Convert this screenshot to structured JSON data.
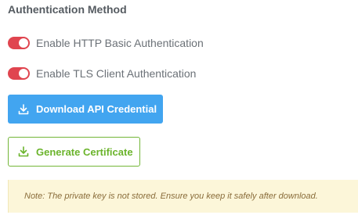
{
  "section": {
    "title": "Authentication Method"
  },
  "toggles": [
    {
      "label": "Enable HTTP Basic Authentication",
      "enabled": true
    },
    {
      "label": "Enable TLS Client Authentication",
      "enabled": true
    }
  ],
  "buttons": {
    "download_label": "Download API Credential",
    "download_icon": "download-icon",
    "generate_label": "Generate Certificate",
    "generate_icon": "download-icon"
  },
  "note": {
    "text": "Note: The private key is not stored. Ensure you keep it safely after download."
  },
  "colors": {
    "toggle_on": "#e0454f",
    "primary": "#42a5f0",
    "success": "#73b637",
    "note_bg": "#fcf6d9"
  }
}
